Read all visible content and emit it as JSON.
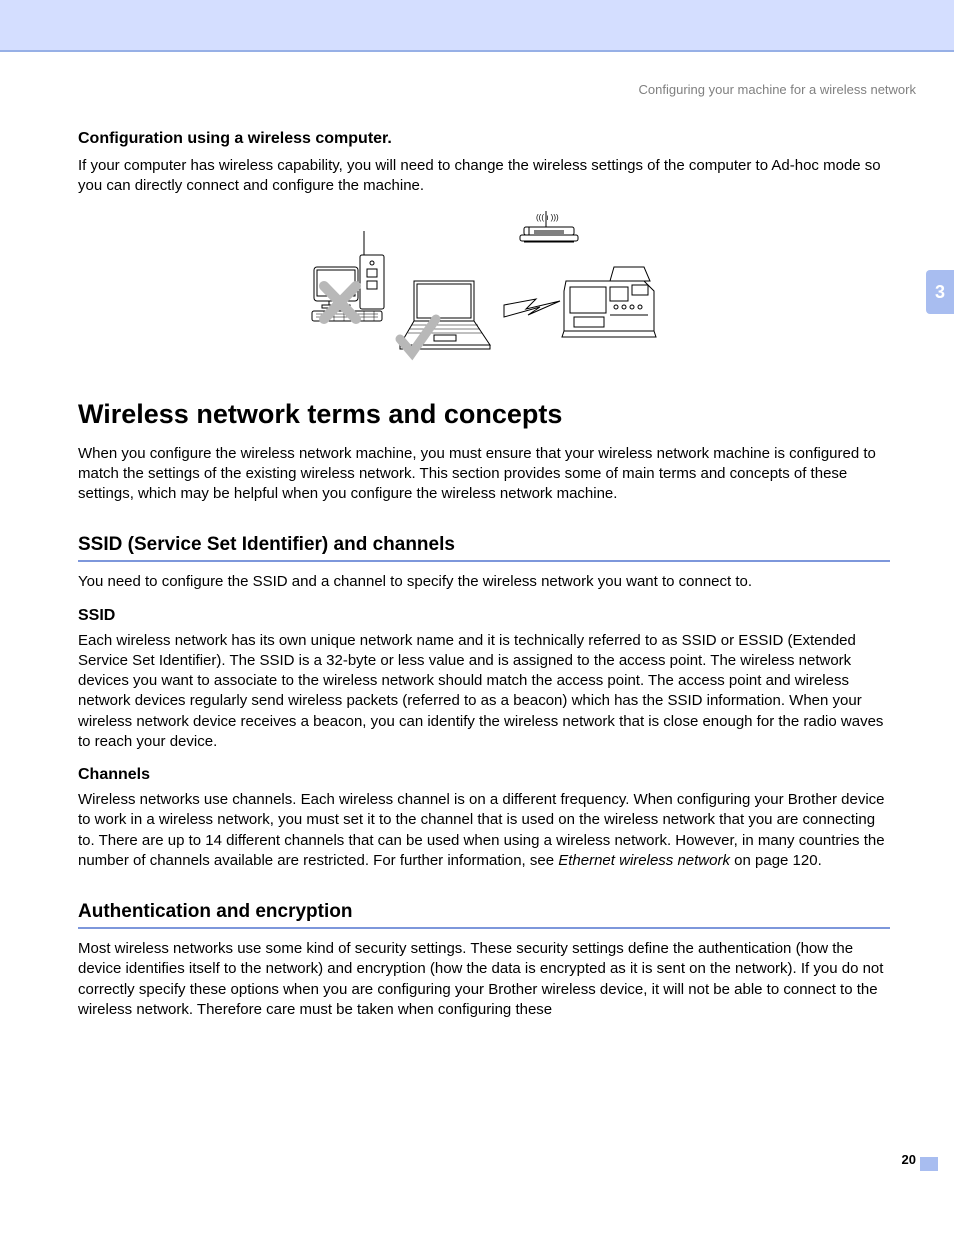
{
  "header": {
    "breadcrumb": "Configuring your machine for a wireless network",
    "chapter_tab": "3"
  },
  "section1": {
    "subheading": "Configuration using a wireless computer.",
    "body": "If your computer has wireless capability, you will need to change the wireless settings of the computer to Ad-hoc mode so you can directly connect and configure the machine."
  },
  "main_heading": "Wireless network terms and concepts",
  "intro_body": "When you configure the wireless network machine, you must ensure that your wireless network machine is configured to match the settings of the existing wireless network. This section provides some of main terms and concepts of these settings, which may be helpful when you configure the wireless network machine.",
  "ssid_section": {
    "heading": "SSID (Service Set Identifier) and channels",
    "intro": "You need to configure the SSID and a channel to specify the wireless network you want to connect to.",
    "ssid_label": "SSID",
    "ssid_body": "Each wireless network has its own unique network name and it is technically referred to as SSID or ESSID (Extended Service Set Identifier). The SSID is a 32-byte or less value and is assigned to the access point. The wireless network devices you want to associate to the wireless network should match the access point. The access point and wireless network devices regularly send wireless packets (referred to as a beacon) which has the SSID information. When your wireless network device receives a beacon, you can identify the wireless network that is close enough for the radio waves to reach your device.",
    "channels_label": "Channels",
    "channels_body_a": "Wireless networks use channels. Each wireless channel is on a different frequency. When configuring your Brother device to work in a wireless network, you must set it to the channel that is used on the wireless network that you are connecting to. There are up to 14 different channels that can be used when using a wireless network. However, in many countries the number of channels available are restricted. For further information, see ",
    "channels_ref": "Ethernet wireless network",
    "channels_body_b": " on page 120."
  },
  "auth_section": {
    "heading": "Authentication and encryption",
    "body": "Most wireless networks use some kind of security settings. These security settings define the authentication (how the device identifies itself to the network) and encryption (how the data is encrypted as it is sent on the network). If you do not correctly specify these options when you are configuring your Brother wireless device, it will not be able to connect to the wireless network. Therefore care must be taken when configuring these"
  },
  "page_number": "20"
}
